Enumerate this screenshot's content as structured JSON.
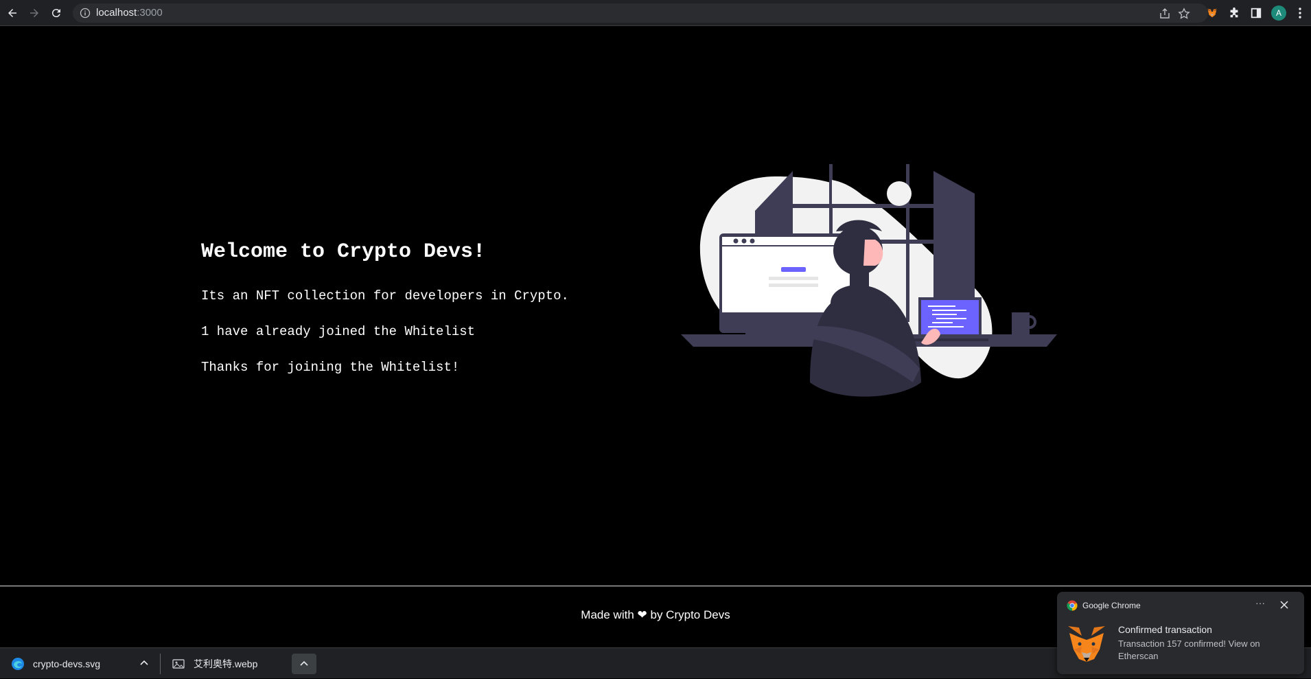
{
  "browser": {
    "url_host": "localhost",
    "url_port": ":3000",
    "avatar_letter": "A"
  },
  "hero": {
    "title": "Welcome to Crypto Devs!",
    "description": "Its an NFT collection for developers in Crypto.",
    "joined_count_text": "1 have already joined the Whitelist",
    "status_text": "Thanks for joining the Whitelist!"
  },
  "footer": {
    "prefix": "Made with",
    "suffix": "by Crypto Devs"
  },
  "downloads": [
    {
      "name": "crypto-devs.svg",
      "icon": "edge-icon"
    },
    {
      "name": "艾利奥特.webp",
      "icon": "image-file-icon"
    }
  ],
  "notification": {
    "app": "Google Chrome",
    "title": "Confirmed transaction",
    "body": "Transaction 157 confirmed! View on Etherscan",
    "more_label": "···"
  },
  "colors": {
    "accent_purple": "#6c63ff",
    "illustration_dark": "#3f3d56",
    "illustration_light": "#f2f2f2"
  }
}
